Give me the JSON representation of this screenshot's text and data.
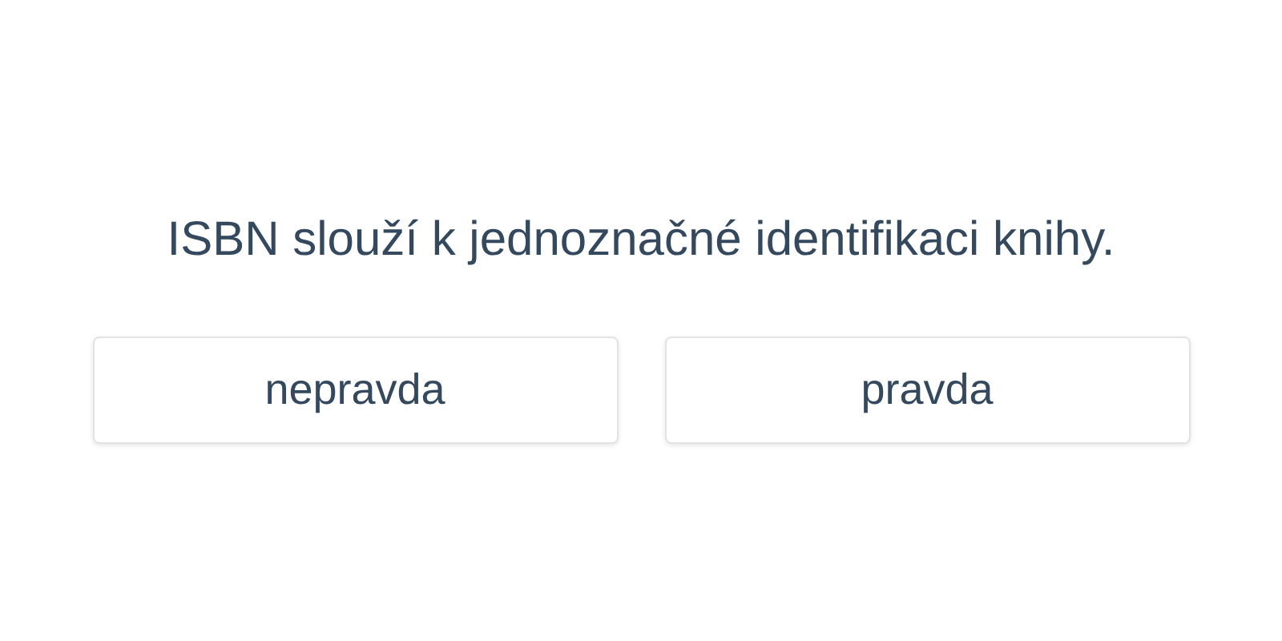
{
  "question": "ISBN slouží k jednoznačné identifikaci knihy.",
  "options": [
    "nepravda",
    "pravda"
  ]
}
